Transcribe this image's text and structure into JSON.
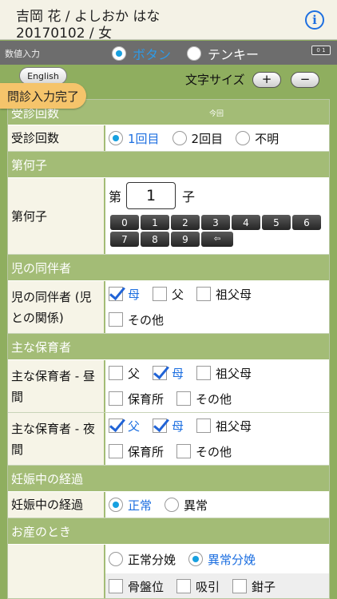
{
  "header": {
    "name": "吉岡 花 / よしおか はな",
    "sub": "20170102 / 女",
    "info_glyph": "i"
  },
  "input_mode": {
    "label": "数値入力",
    "options": [
      {
        "label": "ボタン",
        "selected": true
      },
      {
        "label": "テンキー",
        "selected": false
      }
    ],
    "keypad_glyph": "0 1"
  },
  "controls": {
    "english": "English",
    "font_size_label": "文字サイズ",
    "plus": "+",
    "minus": "−",
    "complete": "問診入力完了"
  },
  "form": {
    "visit": {
      "section": "受診回数",
      "sub_header": "今回",
      "label": "受診回数",
      "options": [
        "1回目",
        "2回目",
        "不明"
      ]
    },
    "birth_order": {
      "section": "第何子",
      "label": "第何子",
      "prefix": "第",
      "value": "1",
      "suffix": "子",
      "keys": [
        "0",
        "1",
        "2",
        "3",
        "4",
        "5",
        "6",
        "7",
        "8",
        "9",
        "⇦"
      ]
    },
    "companion": {
      "section": "児の同伴者",
      "label": "児の同伴者 (児との関係)",
      "options": [
        "母",
        "父",
        "祖父母",
        "その他"
      ]
    },
    "caregiver": {
      "section": "主な保育者",
      "day_label": "主な保育者 - 昼間",
      "night_label": "主な保育者 - 夜間",
      "options_day": [
        "父",
        "母",
        "祖父母",
        "保育所",
        "その他"
      ],
      "options_night": [
        "父",
        "母",
        "祖父母",
        "保育所",
        "その他"
      ]
    },
    "pregnancy": {
      "section": "妊娠中の経過",
      "label": "妊娠中の経過",
      "options": [
        "正常",
        "異常"
      ]
    },
    "delivery": {
      "section": "お産のとき",
      "options": [
        "正常分娩",
        "異常分娩"
      ],
      "sub_options": [
        "骨盤位",
        "吸引",
        "鉗子"
      ]
    }
  }
}
